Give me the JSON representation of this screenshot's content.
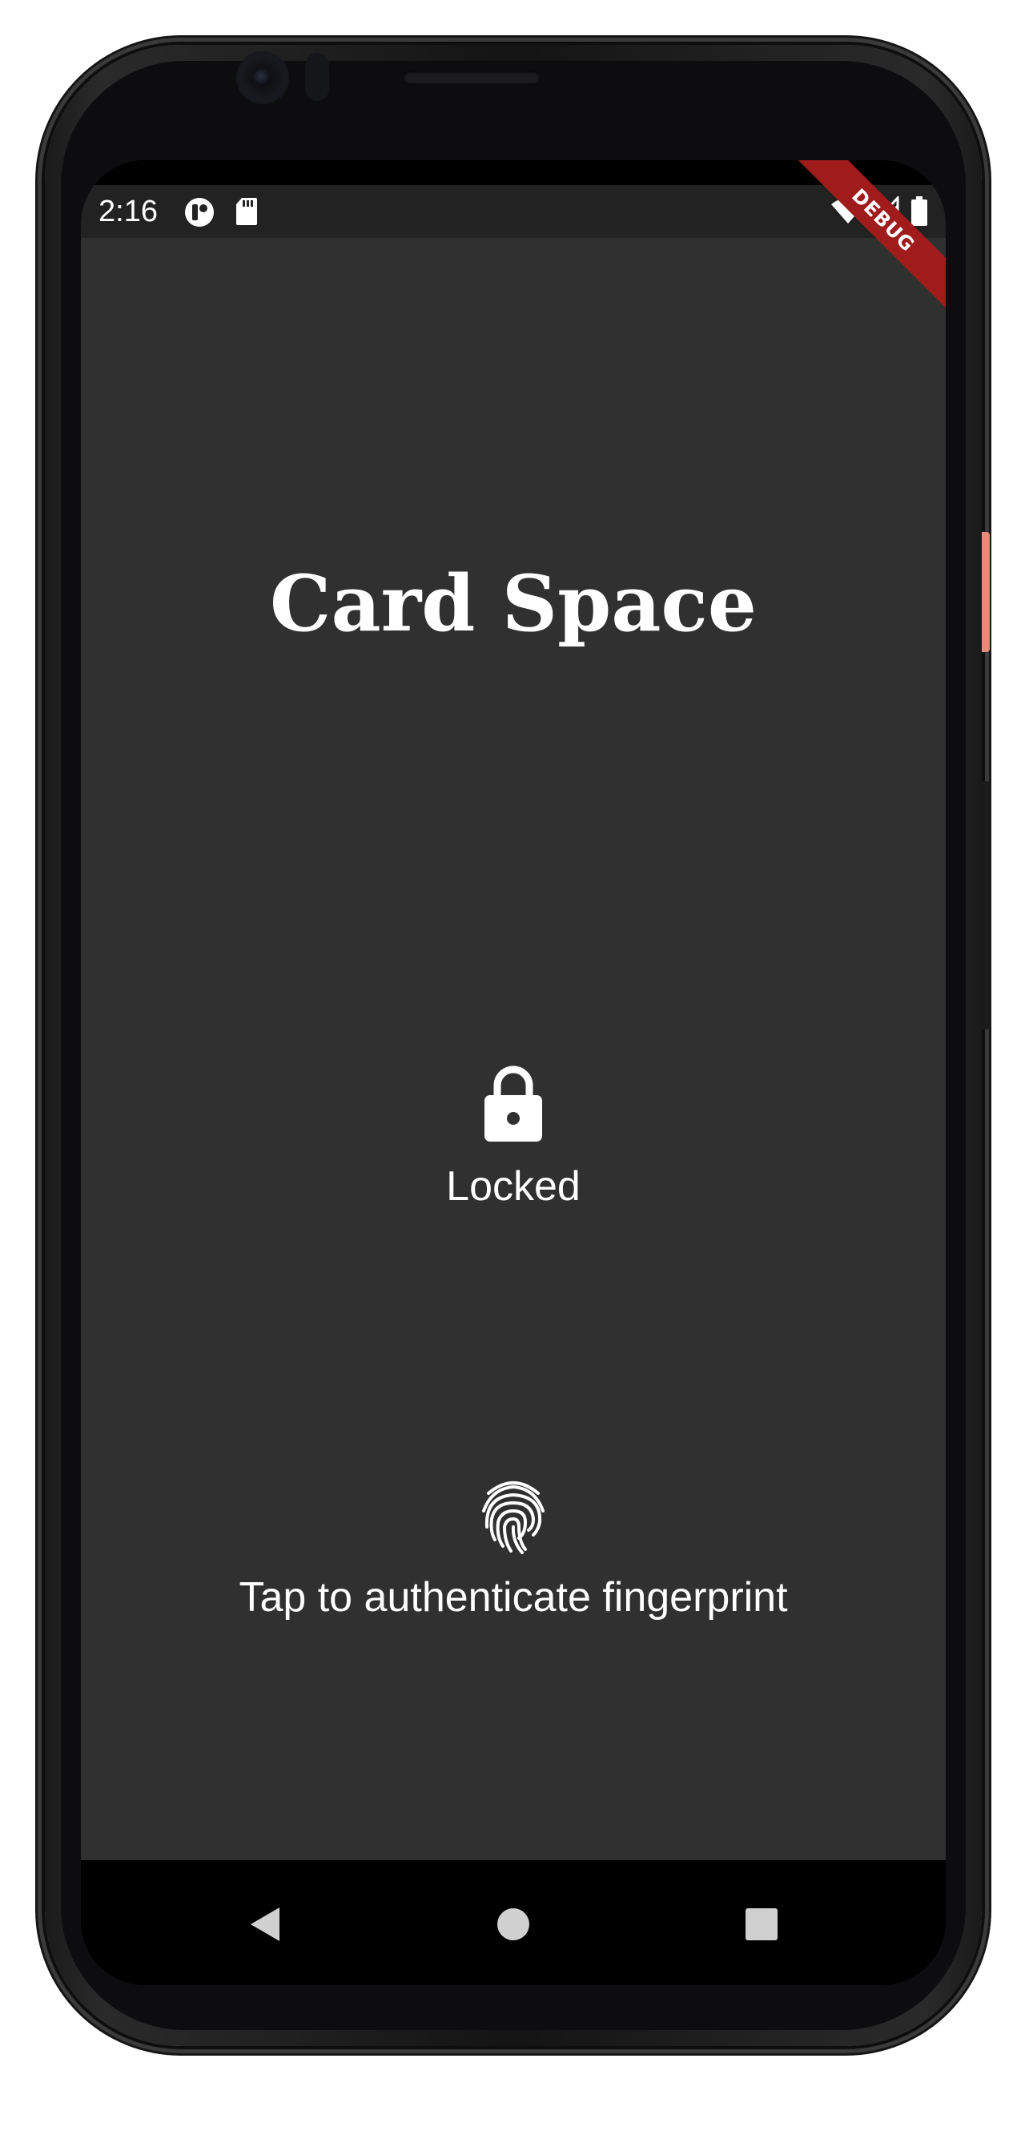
{
  "status_bar": {
    "time": "2:16",
    "icons": [
      "app-notification-icon",
      "sd-card-icon",
      "wifi-icon",
      "cell-signal-icon",
      "battery-icon"
    ]
  },
  "debug_banner": {
    "label": "DEBUG",
    "color": "#a01c1c"
  },
  "app": {
    "title": "Card Space",
    "background": "#303030",
    "lock": {
      "icon": "lock-icon",
      "label": "Locked"
    },
    "auth": {
      "icon": "fingerprint-icon",
      "label": "Tap to authenticate fingerprint"
    }
  },
  "nav_bar": {
    "buttons": [
      "back-icon",
      "home-icon",
      "recents-icon"
    ]
  }
}
